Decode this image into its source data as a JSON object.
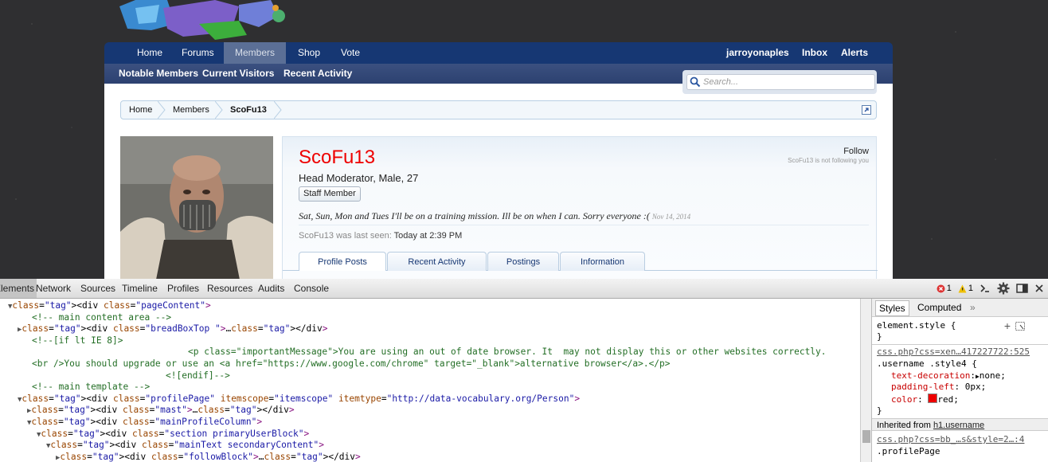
{
  "nav": {
    "tabs": [
      "Home",
      "Forums",
      "Members",
      "Shop",
      "Vote"
    ],
    "selected": "Members",
    "right": [
      "jarroyonaples",
      "Inbox",
      "Alerts"
    ],
    "sub": [
      "Notable Members",
      "Current Visitors",
      "Recent Activity"
    ]
  },
  "search": {
    "placeholder": "Search..."
  },
  "breadcrumb": [
    "Home",
    "Members",
    "ScoFu13"
  ],
  "profile": {
    "username": "ScoFu13",
    "title": "Head Moderator, Male, 27",
    "badge": "Staff Member",
    "status": "Sat, Sun, Mon and Tues I'll be on a training mission. Ill be on when I can. Sorry everyone :(",
    "status_date": "Nov 14, 2014",
    "last_seen_label": "ScoFu13 was last seen:",
    "last_seen_value": "Today at 2:39 PM",
    "follow": "Follow",
    "follow_note": "ScoFu13 is not following you",
    "tabs": [
      "Profile Posts",
      "Recent Activity",
      "Postings",
      "Information"
    ]
  },
  "devtools": {
    "tabs": [
      "Elements",
      "Network",
      "Sources",
      "Timeline",
      "Profiles",
      "Resources",
      "Audits",
      "Console"
    ],
    "errors": "1",
    "warnings": "1",
    "side_tabs": [
      "Styles",
      "Computed"
    ],
    "code": [
      {
        "open": true,
        "html": "<div class=\"pageContent\">"
      },
      {
        "comment": "<!-- main content area -->"
      },
      {
        "open": false,
        "html": "<div class=\"breadBoxTop \">…</div>"
      },
      {
        "comment": "<!--[if lt IE 8]>"
      },
      {
        "comment": "<p class=\"importantMessage\">You are using an out of date browser. It  may not display this or other websites correctly."
      },
      {
        "comment": "<br />You should upgrade or use an <a href=\"https://www.google.com/chrome\" target=\"_blank\">alternative browser</a>.</p>"
      },
      {
        "comment": "<![endif]-->"
      },
      {
        "comment": "<!-- main template -->"
      },
      {
        "open": true,
        "html": "<div class=\"profilePage\" itemscope=\"itemscope\" itemtype=\"http://data-vocabulary.org/Person\">"
      },
      {
        "open": false,
        "html": "<div class=\"mast\">…</div>"
      },
      {
        "open": true,
        "html": "<div class=\"mainProfileColumn\">"
      },
      {
        "open": true,
        "html": "<div class=\"section primaryUserBlock\">"
      },
      {
        "open": true,
        "html": "<div class=\"mainText secondaryContent\">"
      },
      {
        "open": false,
        "html": "<div class=\"followBlock\">…</div>"
      }
    ],
    "styles": {
      "element_style": "element.style {",
      "source1": "css.php?css=xen…417227722:525",
      "selector1": ".username .style4 {",
      "props": [
        {
          "name": "text-decoration",
          "value": "none;"
        },
        {
          "name": "padding-left",
          "value": "0px;"
        },
        {
          "name": "color",
          "value": "red;"
        }
      ],
      "inherited_label": "Inherited from",
      "inherited_from": "h1.username",
      "source2": "css.php?css=bb_…s&style=2…:4",
      "selector2": ".profilePage"
    }
  }
}
